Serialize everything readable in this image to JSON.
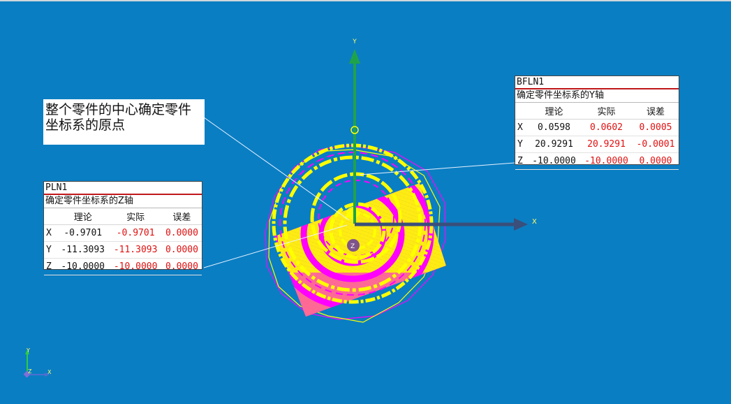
{
  "note": {
    "text": "整个零件的中心确定零件坐标系的原点"
  },
  "plane_z": {
    "name": "PLN1",
    "desc": "确定零件坐标系的Z轴",
    "headers": [
      "理论",
      "实际",
      "误差"
    ],
    "rows": [
      {
        "axis": "X",
        "theory": "-0.9701",
        "actual": "-0.9701",
        "error": "0.0000"
      },
      {
        "axis": "Y",
        "theory": "-11.3093",
        "actual": "-11.3093",
        "error": "0.0000"
      },
      {
        "axis": "Z",
        "theory": "-10.0000",
        "actual": "-10.0000",
        "error": "0.0000"
      }
    ]
  },
  "plane_y": {
    "name": "BFLN1",
    "desc": "确定零件坐标系的Y轴",
    "headers": [
      "理论",
      "实际",
      "误差"
    ],
    "rows": [
      {
        "axis": "X",
        "theory": "0.0598",
        "actual": "0.0602",
        "error": "0.0005"
      },
      {
        "axis": "Y",
        "theory": "20.9291",
        "actual": "20.9291",
        "error": "-0.0001"
      },
      {
        "axis": "Z",
        "theory": "-10.0000",
        "actual": "-10.0000",
        "error": "0.0000"
      }
    ]
  },
  "axes": {
    "x": "X",
    "y": "Y",
    "z": "Z"
  },
  "triad": {
    "x": "X",
    "y": "Y",
    "z": "Z"
  },
  "colors": {
    "background": "#0a7ec3",
    "points_yellow": "#ffff00",
    "points_magenta": "#ff00ff",
    "x_axis": "#3a4f7a",
    "y_axis": "#1fa34a",
    "z_axis": "#6a3aa0",
    "error_red": "#e01010",
    "title_rule": "#c0171b"
  }
}
